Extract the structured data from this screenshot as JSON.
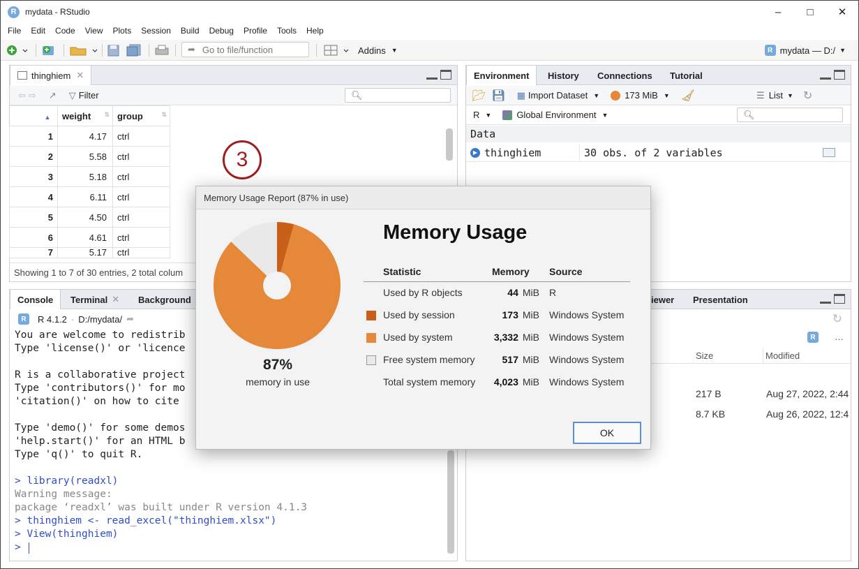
{
  "window": {
    "title": "mydata - RStudio",
    "app_icon": "R"
  },
  "menu": [
    "File",
    "Edit",
    "Code",
    "View",
    "Plots",
    "Session",
    "Build",
    "Debug",
    "Profile",
    "Tools",
    "Help"
  ],
  "toolbar": {
    "goto_placeholder": "Go to file/function",
    "addins_label": "Addins",
    "project_label": "mydata — D:/"
  },
  "source_pane": {
    "tab_label": "thinghiem",
    "filter_label": "Filter",
    "columns": [
      "weight",
      "group"
    ],
    "rows": [
      {
        "n": "1",
        "weight": "4.17",
        "group": "ctrl"
      },
      {
        "n": "2",
        "weight": "5.58",
        "group": "ctrl"
      },
      {
        "n": "3",
        "weight": "5.18",
        "group": "ctrl"
      },
      {
        "n": "4",
        "weight": "6.11",
        "group": "ctrl"
      },
      {
        "n": "5",
        "weight": "4.50",
        "group": "ctrl"
      },
      {
        "n": "6",
        "weight": "4.61",
        "group": "ctrl"
      },
      {
        "n": "7",
        "weight": "5.17",
        "group": "ctrl"
      }
    ],
    "status": "Showing 1 to 7 of 30 entries, 2 total colum"
  },
  "console_pane": {
    "tabs": [
      "Console",
      "Terminal",
      "Background"
    ],
    "r_version": "R 4.1.2",
    "path": "D:/mydata/",
    "lines": [
      {
        "text": "You are welcome to redistrib",
        "style": ""
      },
      {
        "text": "Type 'license()' or 'licence",
        "style": ""
      },
      {
        "text": "",
        "style": ""
      },
      {
        "text": "R is a collaborative project",
        "style": ""
      },
      {
        "text": "Type 'contributors()' for mo",
        "style": ""
      },
      {
        "text": "'citation()' on how to cite ",
        "style": ""
      },
      {
        "text": "",
        "style": ""
      },
      {
        "text": "Type 'demo()' for some demos",
        "style": ""
      },
      {
        "text": "'help.start()' for an HTML b",
        "style": ""
      },
      {
        "text": "Type 'q()' to quit R.",
        "style": ""
      },
      {
        "text": "",
        "style": ""
      },
      {
        "text": "> library(readxl)",
        "style": "blue"
      },
      {
        "text": "Warning message:",
        "style": "gray"
      },
      {
        "text": "package ‘readxl’ was built under R version 4.1.3",
        "style": "gray"
      },
      {
        "text": "> thinghiem <- read_excel(\"thinghiem.xlsx\")",
        "style": "blue"
      },
      {
        "text": "> View(thinghiem)",
        "style": "blue"
      },
      {
        "text": "> ",
        "style": "blue"
      }
    ]
  },
  "env_pane": {
    "tabs": [
      "Environment",
      "History",
      "Connections",
      "Tutorial"
    ],
    "import_label": "Import Dataset",
    "memory_label": "173 MiB",
    "list_label": "List",
    "lang_label": "R",
    "scope_label": "Global Environment",
    "section": "Data",
    "object_name": "thinghiem",
    "object_desc": "30 obs. of 2 variables"
  },
  "files_pane": {
    "tabs": [
      "iewer",
      "Presentation"
    ],
    "columns": [
      "Size",
      "Modified"
    ],
    "rows": [
      {
        "size": "217 B",
        "modified": "Aug 27, 2022, 2:44"
      },
      {
        "size": "8.7 KB",
        "modified": "Aug 26, 2022, 12:4"
      }
    ]
  },
  "step_marker": "3",
  "dialog": {
    "title": "Memory Usage Report (87% in use)",
    "heading": "Memory Usage",
    "percent": "87%",
    "percent_label": "memory in use",
    "columns": [
      "Statistic",
      "Memory",
      "Source"
    ],
    "rows": [
      {
        "label": "Used by R objects",
        "value": "44",
        "unit": "MiB",
        "source": "R",
        "swatch": ""
      },
      {
        "label": "Used by session",
        "value": "173",
        "unit": "MiB",
        "source": "Windows System",
        "swatch": "#c9601a"
      },
      {
        "label": "Used by system",
        "value": "3,332",
        "unit": "MiB",
        "source": "Windows System",
        "swatch": "#e5883a"
      },
      {
        "label": "Free system memory",
        "value": "517",
        "unit": "MiB",
        "source": "Windows System",
        "swatch": "#e9e9e9"
      },
      {
        "label": "Total system memory",
        "value": "4,023",
        "unit": "MiB",
        "source": "Windows System",
        "swatch": ""
      }
    ],
    "ok_label": "OK"
  },
  "chart_data": {
    "type": "pie",
    "categories": [
      "Used by session",
      "Used by system",
      "Free system memory"
    ],
    "values": [
      173,
      3332,
      517
    ],
    "colors": [
      "#c9601a",
      "#e5883a",
      "#e9e9e9"
    ]
  }
}
